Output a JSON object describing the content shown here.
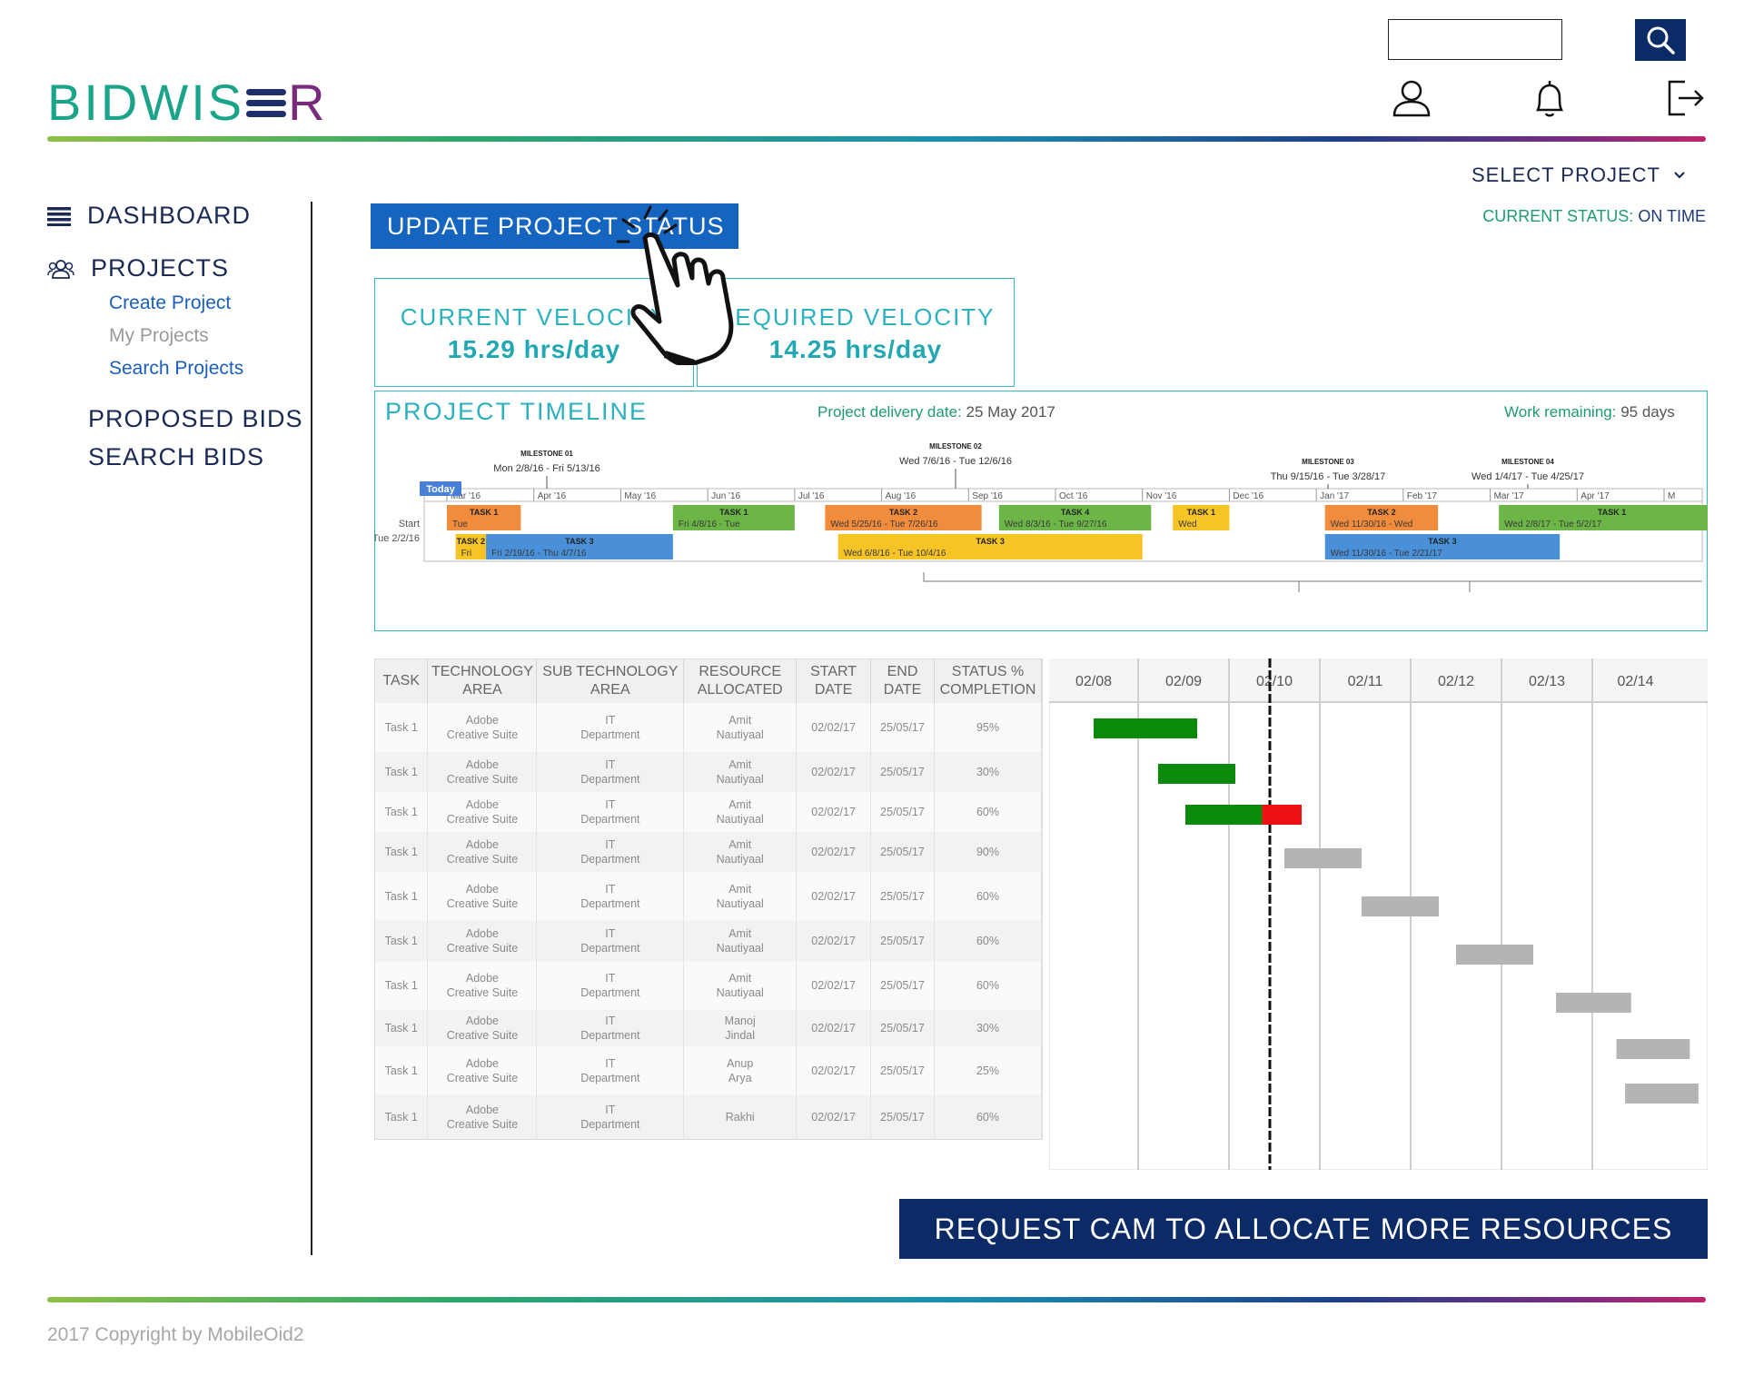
{
  "header": {
    "search_placeholder": "",
    "icons": [
      "search-icon",
      "user-icon",
      "bell-icon",
      "logout-icon"
    ]
  },
  "brand": {
    "primary": "#0b2b66",
    "accent": "#1565c0",
    "teal": "#2bb1bf",
    "green": "#1e9b72"
  },
  "project": {
    "select_label": "SELECT PROJECT",
    "status_label": "CURRENT STATUS:",
    "status_value": "ON TIME"
  },
  "sidebar": {
    "dashboard": "DASHBOARD",
    "projects": "PROJECTS",
    "sub": [
      "Create Project",
      "My Projects",
      "Search Projects"
    ],
    "proposed_bids": "PROPOSED BIDS",
    "search_bids": "SEARCH BIDS"
  },
  "actions": {
    "update_status": "UPDATE PROJECT STATUS",
    "request_cam": "REQUEST CAM TO ALLOCATE MORE RESOURCES"
  },
  "velocity": {
    "current_label": "CURRENT VELOCITY",
    "current_value": "15.29 hrs/day",
    "required_label": "REQUIRED VELOCITY",
    "required_value": "14.25 hrs/day"
  },
  "timeline": {
    "title": "PROJECT TIMELINE",
    "delivery_label": "Project delivery date:",
    "delivery_value": "25 May 2017",
    "remaining_label": "Work remaining:",
    "remaining_value": "95 days",
    "today": "Today",
    "start": "Start",
    "start_date": "Tue 2/2/16",
    "months": [
      "Mar '16",
      "Apr '16",
      "May '16",
      "Jun '16",
      "Jul '16",
      "Aug '16",
      "Sep '16",
      "Oct '16",
      "Nov '16",
      "Dec '16",
      "Jan '17",
      "Feb '17",
      "Mar '17",
      "Apr '17",
      "M"
    ],
    "milestones": [
      {
        "name": "MILESTONE 01",
        "dates": "Mon 2/8/16 - Fri 5/13/16"
      },
      {
        "name": "MILESTONE 02",
        "dates": "Wed 7/6/16 - Tue 12/6/16"
      },
      {
        "name": "MILESTONE 03",
        "dates": "Thu 9/15/16 - Tue 3/28/17"
      },
      {
        "name": "MILESTONE 04",
        "dates": "Wed 1/4/17 - Tue 4/25/17"
      }
    ],
    "bars": [
      {
        "name": "TASK 1",
        "dates": "Tue",
        "color": "#f08c3c",
        "row": 0
      },
      {
        "name": "TASK 1",
        "dates": "Fri 4/8/16 - Tue",
        "color": "#6cb547",
        "row": 0
      },
      {
        "name": "TASK 2",
        "dates": "Wed 5/25/16 - Tue 7/26/16",
        "color": "#f08c3c",
        "row": 0
      },
      {
        "name": "TASK 4",
        "dates": "Wed 8/3/16 - Tue 9/27/16",
        "color": "#6cb547",
        "row": 0
      },
      {
        "name": "TASK 1",
        "dates": "Wed",
        "color": "#f7c425",
        "row": 0
      },
      {
        "name": "TASK 2",
        "dates": "Wed 11/30/16 - Wed",
        "color": "#f08c3c",
        "row": 0
      },
      {
        "name": "TASK 1",
        "dates": "Wed 2/8/17 - Tue 5/2/17",
        "color": "#6cb547",
        "row": 0
      },
      {
        "name": "TASK 2",
        "dates": "Fri",
        "color": "#f7c425",
        "row": 1
      },
      {
        "name": "TASK 3",
        "dates": "Fri 2/19/16 - Thu 4/7/16",
        "color": "#4a90d9",
        "row": 1
      },
      {
        "name": "TASK 3",
        "dates": "Wed 6/8/16 - Tue 10/4/16",
        "color": "#f7c425",
        "row": 1
      },
      {
        "name": "TASK 3",
        "dates": "Wed 11/30/16 - Tue 2/21/17",
        "color": "#4a90d9",
        "row": 1
      }
    ]
  },
  "table": {
    "headers": [
      [
        "TASK"
      ],
      [
        "TECHNOLOGY",
        "AREA"
      ],
      [
        "SUB TECHNOLOGY",
        "AREA"
      ],
      [
        "RESOURCE",
        "ALLOCATED"
      ],
      [
        "START",
        "DATE"
      ],
      [
        "END",
        "DATE"
      ],
      [
        "STATUS  %",
        "COMPLETION"
      ]
    ],
    "rows": [
      {
        "task": "Task 1",
        "tech": [
          "Adobe",
          "Creative Suite"
        ],
        "sub": [
          "IT",
          "Department"
        ],
        "res": [
          "Amit",
          "Nautiyaal"
        ],
        "start": "02/02/17",
        "end": "25/05/17",
        "status": "95%"
      },
      {
        "task": "Task 1",
        "tech": [
          "Adobe",
          "Creative Suite"
        ],
        "sub": [
          "IT",
          "Department"
        ],
        "res": [
          "Amit",
          "Nautiyaal"
        ],
        "start": "02/02/17",
        "end": "25/05/17",
        "status": "30%"
      },
      {
        "task": "Task 1",
        "tech": [
          "Adobe",
          "Creative Suite"
        ],
        "sub": [
          "IT",
          "Department"
        ],
        "res": [
          "Amit",
          "Nautiyaal"
        ],
        "start": "02/02/17",
        "end": "25/05/17",
        "status": "60%"
      },
      {
        "task": "Task 1",
        "tech": [
          "Adobe",
          "Creative Suite"
        ],
        "sub": [
          "IT",
          "Department"
        ],
        "res": [
          "Amit",
          "Nautiyaal"
        ],
        "start": "02/02/17",
        "end": "25/05/17",
        "status": "90%"
      },
      {
        "task": "Task 1",
        "tech": [
          "Adobe",
          "Creative Suite"
        ],
        "sub": [
          "IT",
          "Department"
        ],
        "res": [
          "Amit",
          "Nautiyaal"
        ],
        "start": "02/02/17",
        "end": "25/05/17",
        "status": "60%"
      },
      {
        "task": "Task 1",
        "tech": [
          "Adobe",
          "Creative Suite"
        ],
        "sub": [
          "IT",
          "Department"
        ],
        "res": [
          "Amit",
          "Nautiyaal"
        ],
        "start": "02/02/17",
        "end": "25/05/17",
        "status": "60%"
      },
      {
        "task": "Task 1",
        "tech": [
          "Adobe",
          "Creative Suite"
        ],
        "sub": [
          "IT",
          "Department"
        ],
        "res": [
          "Amit",
          "Nautiyaal"
        ],
        "start": "02/02/17",
        "end": "25/05/17",
        "status": "60%"
      },
      {
        "task": "Task 1",
        "tech": [
          "Adobe",
          "Creative Suite"
        ],
        "sub": [
          "IT",
          "Department"
        ],
        "res": [
          "Manoj",
          "Jindal"
        ],
        "start": "02/02/17",
        "end": "25/05/17",
        "status": "30%"
      },
      {
        "task": "Task 1",
        "tech": [
          "Adobe",
          "Creative Suite"
        ],
        "sub": [
          "IT",
          "Department"
        ],
        "res": [
          "Anup",
          "Arya"
        ],
        "start": "02/02/17",
        "end": "25/05/17",
        "status": "25%"
      },
      {
        "task": "Task 1",
        "tech": [
          "Adobe",
          "Creative Suite"
        ],
        "sub": [
          "IT",
          "Department"
        ],
        "res": [
          "Rakhi"
        ],
        "start": "02/02/17",
        "end": "25/05/17",
        "status": "60%"
      }
    ]
  },
  "gantt": {
    "days": [
      "02/08",
      "02/09",
      "02/10",
      "02/11",
      "02/12",
      "02/13",
      "02/14"
    ],
    "today_index": 2.45,
    "bars": [
      {
        "start": 0.5,
        "len": 1.15,
        "done": 1.0
      },
      {
        "start": 1.22,
        "len": 0.85,
        "done": 1.0
      },
      {
        "start": 1.52,
        "len": 1.28,
        "done": 0.66
      },
      {
        "start": 2.61,
        "len": 0.85,
        "done": 0
      },
      {
        "start": 3.46,
        "len": 0.85,
        "done": 0
      },
      {
        "start": 4.5,
        "len": 0.85,
        "done": 0
      },
      {
        "start": 5.6,
        "len": 0.85,
        "done": 0
      },
      {
        "start": 6.28,
        "len": 0.85,
        "done": 0
      },
      {
        "start": 6.38,
        "len": 0.85,
        "done": 0
      }
    ],
    "colors": {
      "done": "#0a8a0a",
      "late": "#ee1111",
      "pending": "#b4b4b4"
    }
  },
  "footer": {
    "copyright": "2017 Copyright by MobileOid2"
  }
}
